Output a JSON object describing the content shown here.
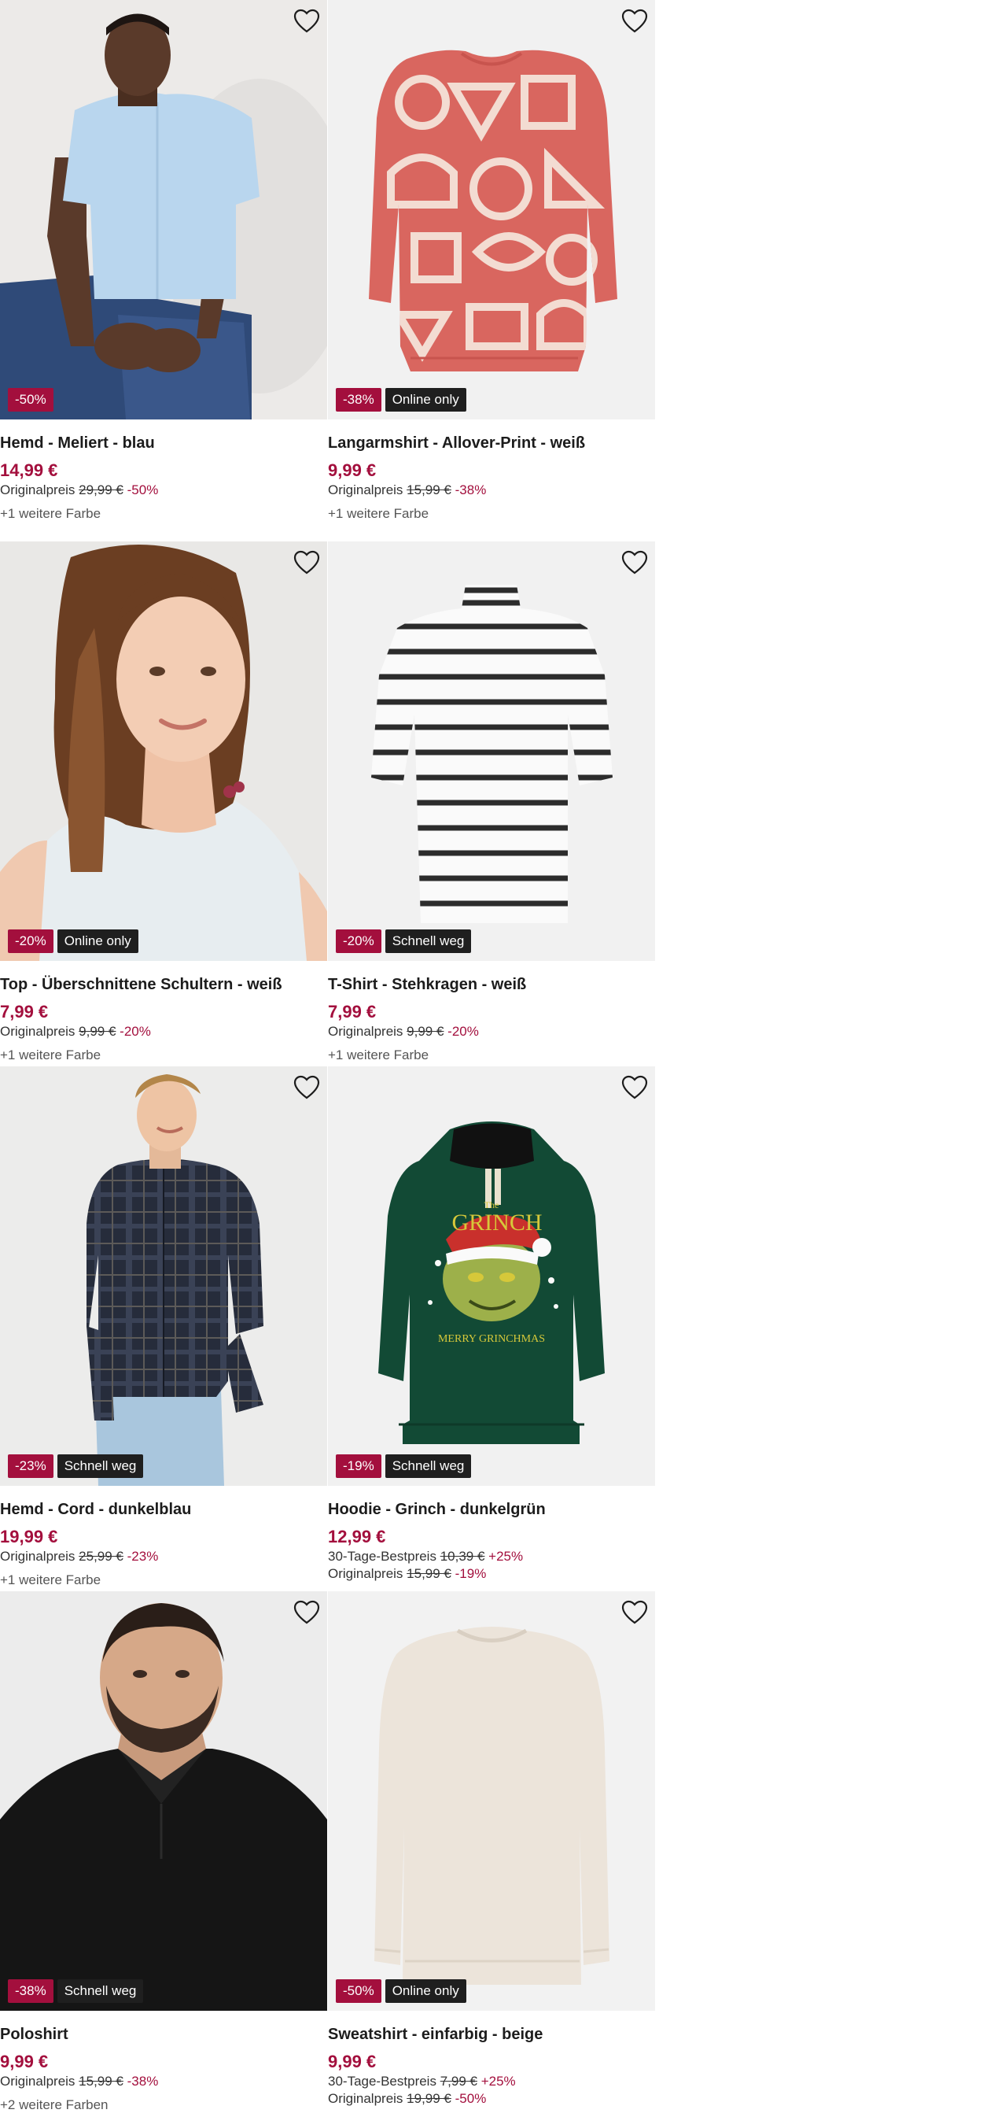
{
  "products": [
    {
      "title": "Hemd - Meliert - blau",
      "price": "14,99 €",
      "badges": [
        {
          "text": "-50%",
          "kind": "discount"
        }
      ],
      "lines": [
        {
          "label": "Originalpreis",
          "old": "29,99 €",
          "pct": "-50%"
        }
      ],
      "colors": "+1 weitere Farbe",
      "image": "man-light-blue-shirt",
      "wishlist_icon": "heart-outline-icon"
    },
    {
      "title": "Langarmshirt - Allover-Print - weiß",
      "price": "9,99 €",
      "badges": [
        {
          "text": "-38%",
          "kind": "discount"
        },
        {
          "text": "Online only",
          "kind": "tag"
        }
      ],
      "lines": [
        {
          "label": "Originalpreis",
          "old": "15,99 €",
          "pct": "-38%"
        }
      ],
      "colors": "+1 weitere Farbe",
      "image": "red-geometric-print-longsleeve",
      "wishlist_icon": "heart-outline-icon"
    },
    {
      "title": "Top - Überschnittene Schultern - weiß",
      "price": "7,99 €",
      "badges": [
        {
          "text": "-20%",
          "kind": "discount"
        },
        {
          "text": "Online only",
          "kind": "tag"
        }
      ],
      "lines": [
        {
          "label": "Originalpreis",
          "old": "9,99 €",
          "pct": "-20%"
        }
      ],
      "colors": "+1 weitere Farbe",
      "image": "woman-white-top",
      "wishlist_icon": "heart-outline-icon"
    },
    {
      "title": "T-Shirt - Stehkragen - weiß",
      "price": "7,99 €",
      "badges": [
        {
          "text": "-20%",
          "kind": "discount"
        },
        {
          "text": "Schnell weg",
          "kind": "tag"
        }
      ],
      "lines": [
        {
          "label": "Originalpreis",
          "old": "9,99 €",
          "pct": "-20%"
        }
      ],
      "colors": "+1 weitere Farbe",
      "image": "striped-turtleneck-tshirt",
      "wishlist_icon": "heart-outline-icon"
    },
    {
      "title": "Hemd - Cord - dunkelblau",
      "price": "19,99 €",
      "badges": [
        {
          "text": "-23%",
          "kind": "discount"
        },
        {
          "text": "Schnell weg",
          "kind": "tag"
        }
      ],
      "lines": [
        {
          "label": "Originalpreis",
          "old": "25,99 €",
          "pct": "-23%"
        }
      ],
      "colors": "+1 weitere Farbe",
      "image": "man-plaid-cord-shirt",
      "wishlist_icon": "heart-outline-icon"
    },
    {
      "title": "Hoodie - Grinch - dunkelgrün",
      "price": "12,99 €",
      "badges": [
        {
          "text": "-19%",
          "kind": "discount"
        },
        {
          "text": "Schnell weg",
          "kind": "tag"
        }
      ],
      "lines": [
        {
          "label": "30-Tage-Bestpreis",
          "old": "10,39 €",
          "pct": "+25%"
        },
        {
          "label": "Originalpreis",
          "old": "15,99 €",
          "pct": "-19%"
        }
      ],
      "colors": "",
      "image": "green-grinch-hoodie",
      "hoodie_text": {
        "the": "The",
        "grinch": "GRINCH",
        "merry": "MERRY GRINCHMAS"
      },
      "wishlist_icon": "heart-outline-icon"
    },
    {
      "title": "Poloshirt",
      "price": "9,99 €",
      "badges": [
        {
          "text": "-38%",
          "kind": "discount"
        },
        {
          "text": "Schnell weg",
          "kind": "tag"
        }
      ],
      "lines": [
        {
          "label": "Originalpreis",
          "old": "15,99 €",
          "pct": "-38%"
        }
      ],
      "colors": "+2 weitere Farben",
      "image": "man-black-polo",
      "wishlist_icon": "heart-outline-icon"
    },
    {
      "title": "Sweatshirt - einfarbig - beige",
      "price": "9,99 €",
      "badges": [
        {
          "text": "-50%",
          "kind": "discount"
        },
        {
          "text": "Online only",
          "kind": "tag"
        }
      ],
      "lines": [
        {
          "label": "30-Tage-Bestpreis",
          "old": "7,99 €",
          "pct": "+25%"
        },
        {
          "label": "Originalpreis",
          "old": "19,99 €",
          "pct": "-50%"
        }
      ],
      "colors": "",
      "image": "beige-sweatshirt",
      "wishlist_icon": "heart-outline-icon"
    }
  ],
  "colors": {
    "accent": "#a30f3d",
    "tag_bg": "#1f1f1f",
    "image_bg": "#f2f2f2"
  }
}
